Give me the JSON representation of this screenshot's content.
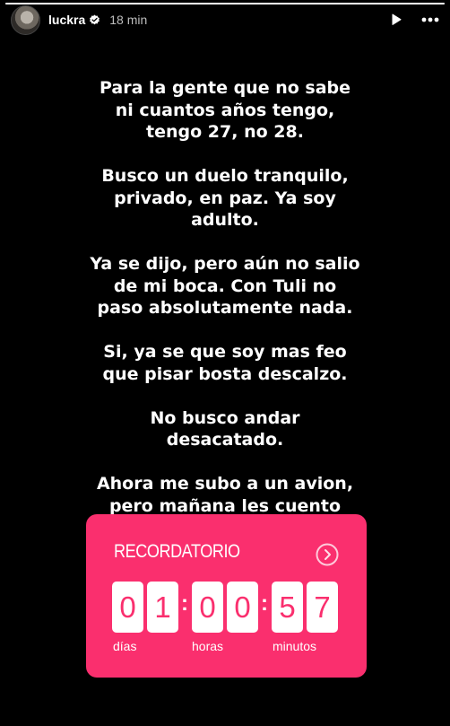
{
  "story": {
    "progress_fraction": 1.0
  },
  "header": {
    "username": "luckra",
    "verified": true,
    "timestamp": "18 min",
    "icons": [
      "avatar",
      "verified-badge-icon",
      "play-icon",
      "more-icon"
    ]
  },
  "text": {
    "paragraphs": [
      "Para la gente que no sabe\nni cuantos años tengo,\ntengo 27, no 28.",
      "Busco un duelo tranquilo,\nprivado, en paz. Ya soy\nadulto.",
      "Ya se dijo, pero aún no salio\nde mi boca. Con Tuli no\npaso absolutamente nada.",
      "Si, ya se que soy mas feo\nque pisar bosta descalzo.",
      "No busco andar\ndesacatado.",
      "Ahora me subo a un avion,\npero mañana les cuento\nmas:"
    ]
  },
  "countdown": {
    "title": "RECORDATORIO",
    "digits": [
      "0",
      "1",
      "0",
      "0",
      "5",
      "7"
    ],
    "units": {
      "days": "días",
      "hours": "horas",
      "minutes": "minutos"
    },
    "colors": {
      "card": "#fa2f6e",
      "digit_bg": "#ffffff",
      "digit_text": "#fa2f6e"
    }
  }
}
